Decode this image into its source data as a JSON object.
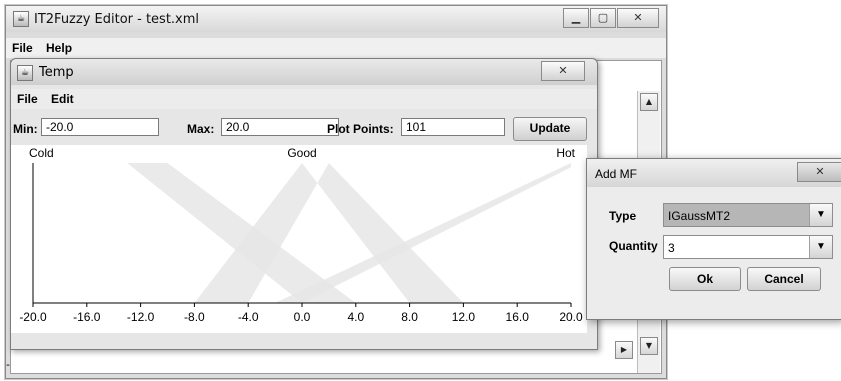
{
  "main_window": {
    "title": "IT2Fuzzy Editor - test.xml",
    "menu": [
      "File",
      "Help"
    ],
    "status_text": "-",
    "icons": {
      "app": "java-app-icon",
      "minimize": "minimize-icon",
      "maximize": "maximize-icon",
      "close": "close-icon"
    }
  },
  "temp_window": {
    "title": "Temp",
    "menu": [
      "File",
      "Edit"
    ],
    "controls": {
      "min_label": "Min:",
      "min_value": "-20.0",
      "max_label": "Max:",
      "max_value": "20.0",
      "points_label": "Plot Points:",
      "points_value": "101",
      "update_label": "Update"
    }
  },
  "chart_data": {
    "type": "line",
    "title": "",
    "xlabel": "",
    "ylabel": "",
    "xlim": [
      -20,
      20
    ],
    "ylim": [
      0,
      1
    ],
    "x_ticks": [
      "-20.0",
      "-16.0",
      "-12.0",
      "-8.0",
      "-4.0",
      "0.0",
      "4.0",
      "8.0",
      "12.0",
      "16.0",
      "20.0"
    ],
    "series": [
      {
        "name": "Cold",
        "upper": [
          [
            -20,
            1
          ],
          [
            -13,
            1
          ],
          [
            0,
            0
          ],
          [
            20,
            0
          ]
        ],
        "lower": [
          [
            -20,
            1
          ],
          [
            -10,
            1
          ],
          [
            4,
            0
          ],
          [
            20,
            0
          ]
        ]
      },
      {
        "name": "Good",
        "upper": [
          [
            -20,
            0
          ],
          [
            -8,
            0
          ],
          [
            0,
            1
          ],
          [
            8,
            0
          ],
          [
            20,
            0
          ]
        ],
        "lower": [
          [
            -20,
            0
          ],
          [
            -4,
            0
          ],
          [
            2,
            1
          ],
          [
            12,
            0
          ],
          [
            20,
            0
          ]
        ]
      },
      {
        "name": "Hot",
        "upper": [
          [
            -20,
            0
          ],
          [
            -2,
            0
          ],
          [
            20,
            1
          ]
        ],
        "lower": [
          [
            -20,
            0
          ],
          [
            0,
            0
          ],
          [
            20,
            0.97
          ]
        ]
      }
    ],
    "grid": false,
    "colors": {
      "band": "#e6e6e6",
      "axis": "#000000"
    }
  },
  "add_mf_dialog": {
    "title": "Add MF",
    "type_label": "Type",
    "type_value": "IGaussMT2",
    "quantity_label": "Quantity",
    "quantity_value": "3",
    "ok_label": "Ok",
    "cancel_label": "Cancel"
  }
}
